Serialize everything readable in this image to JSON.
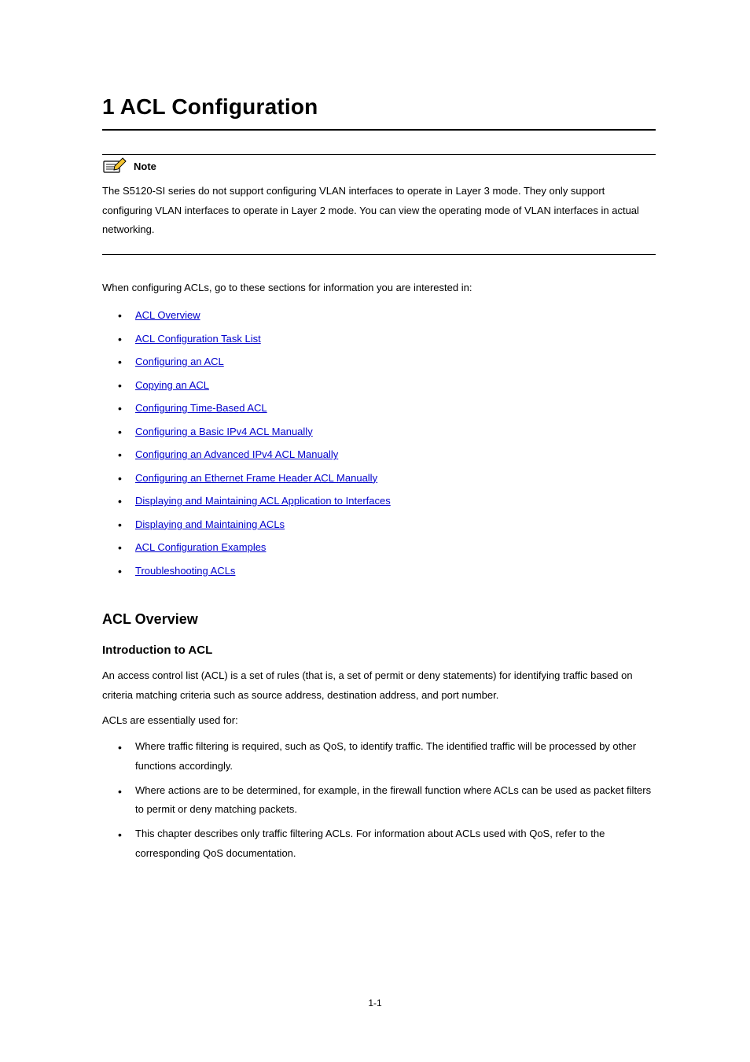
{
  "chapter": {
    "title": "1   ACL Configuration"
  },
  "note": {
    "label": "Note",
    "body": "The S5120-SI series do not support configuring VLAN interfaces to operate in Layer 3 mode. They only support configuring VLAN interfaces to operate in Layer 2 mode. You can view the operating mode of VLAN interfaces in actual networking."
  },
  "intro": "When configuring ACLs, go to these sections for information you are interested in:",
  "links": [
    "ACL Overview",
    "ACL Configuration Task List",
    "Configuring an ACL",
    "Copying an ACL",
    "Configuring Time-Based ACL",
    "Configuring a Basic IPv4 ACL Manually",
    "Configuring an Advanced IPv4 ACL Manually",
    "Configuring an Ethernet Frame Header ACL Manually",
    "Displaying and Maintaining ACL Application to Interfaces",
    "Displaying and Maintaining ACLs",
    "ACL Configuration Examples",
    "Troubleshooting ACLs"
  ],
  "overview": {
    "heading": "ACL Overview",
    "sub": {
      "heading": "Introduction to ACL",
      "p1": "An access control list (ACL) is a set of rules (that is, a set of permit or deny statements) for identifying traffic based on criteria matching criteria such as source address, destination address, and port number.",
      "p2": "ACLs are essentially used for:",
      "items": [
        "Where traffic filtering is required, such as QoS, to identify traffic. The identified traffic will be processed by other functions accordingly.",
        "Where actions are to be determined, for example, in the firewall function where ACLs can be used as packet filters to permit or deny matching packets.",
        "This chapter describes only traffic filtering ACLs. For information about ACLs used with QoS, refer to the corresponding QoS documentation."
      ]
    }
  },
  "pageNumber": "1-1"
}
